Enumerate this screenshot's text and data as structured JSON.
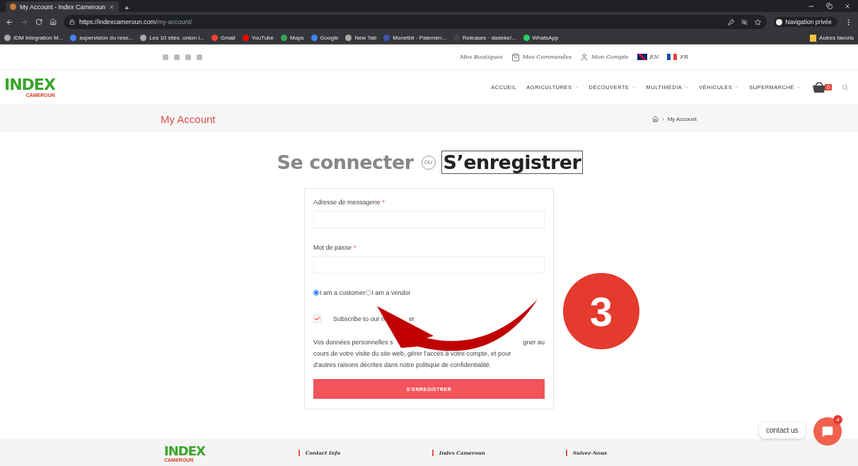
{
  "browser": {
    "tab_title": "My Account - Index Cameroun",
    "new_tab": "+",
    "url_host": "https://indexcameroun.com",
    "url_path": "/my-account/",
    "profile": "Navigation privée",
    "bookmarks": [
      "IDM Integration M...",
      "supervision du rese...",
      "Les 10 sites .onion l...",
      "Gmail",
      "YouTube",
      "Maps",
      "Google",
      "New Tab",
      "Monetbil - Paiemen...",
      "Releases · dadeke/...",
      "WhatsApp"
    ],
    "other_bookmarks": "Autres favoris"
  },
  "topbar": {
    "links": [
      "Mes Boutiques",
      "Mes Commandes",
      "Mon Compte"
    ],
    "languages": [
      "EN",
      "FR"
    ]
  },
  "header": {
    "logo": "INDEX",
    "logo_sub": "CAMEROUN",
    "nav": [
      {
        "label": "ACCUEIL",
        "dropdown": false
      },
      {
        "label": "AGRICULTURES",
        "dropdown": true
      },
      {
        "label": "DÉCOUVERTE",
        "dropdown": true
      },
      {
        "label": "MULTIMÉDIA",
        "dropdown": true
      },
      {
        "label": "VÉHICULES",
        "dropdown": true
      },
      {
        "label": "SUPERMARCHÉ",
        "dropdown": true
      }
    ],
    "cart_count": "0"
  },
  "page_title": "My Account",
  "breadcrumb": "My Account",
  "auth": {
    "login_tab": {
      "label": "Se connecter",
      "selected": false
    },
    "or": "OU",
    "register_tab": {
      "label": "S’enregistrer",
      "selected": true
    }
  },
  "form": {
    "required_mark": "*",
    "fields": [
      {
        "label": "Adresse de messagerie",
        "required": true
      },
      {
        "label": "Mot de passe",
        "required": true
      }
    ],
    "roles": [
      {
        "label": "I am a customer",
        "selected": true
      },
      {
        "label": "I am a vendor",
        "selected": false
      }
    ],
    "newsletter": {
      "label_start": "Subscribe to our n",
      "label_end": "er",
      "checked": true
    },
    "privacy_start": "Vos données personnelles s",
    "privacy_end": "gner au",
    "privacy_rest": "cours de votre visite du site web, gérer l’accès à votre compte, et pour d’autres raisons décrites dans notre politique de confidentialité.",
    "submit": "S’ENREGISTRER"
  },
  "step_badge": "3",
  "chat": {
    "label": "contact us",
    "count": "4"
  },
  "footer": {
    "logo": "INDEX",
    "logo_sub": "CAMEROUN",
    "headings": [
      "Contact Info",
      "Index Cameroun",
      "Suivez-Nous"
    ]
  }
}
